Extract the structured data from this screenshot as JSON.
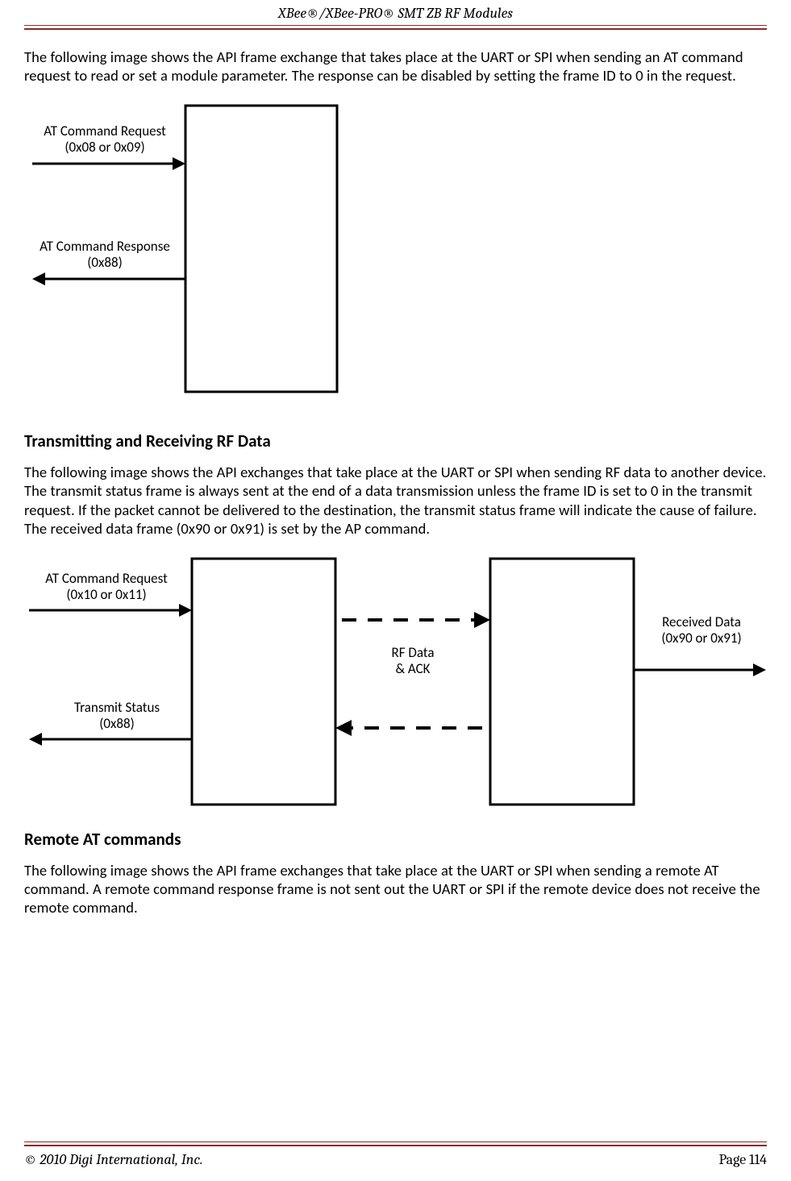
{
  "header": "XBee®/XBee-PRO® SMT ZB RF Modules",
  "paragraph1": "The following image shows the API frame exchange that takes place at the UART or SPI when sending an AT command request to read or set a module parameter. The response can be disabled by setting the frame ID to 0 in the request.",
  "diagram1": {
    "req_line1": "AT Command Request",
    "req_line2": "(0x08 or 0x09)",
    "resp_line1": "AT Command Response",
    "resp_line2": "(0x88)"
  },
  "heading2": "Transmitting and Receiving RF Data",
  "paragraph2": "The following image shows the API exchanges that take place at the UART or SPI when sending RF data to another device. The transmit status frame is always sent at the end of a data transmission unless the frame ID is set to 0 in the transmit request. If the packet cannot be delivered to the destination, the transmit status frame will indicate the cause of failure. The received data frame (0x90 or 0x91) is set by the AP command.",
  "diagram2": {
    "req_line1": "AT Command Request",
    "req_line2": "(0x10 or 0x11)",
    "mid_line1": "RF Data",
    "mid_line2": "& ACK",
    "resp_line1": "Transmit Status",
    "resp_line2": "(0x88)",
    "recv_line1": "Received Data",
    "recv_line2": "(0x90 or 0x91)"
  },
  "heading3": "Remote AT commands",
  "paragraph3": "The following image shows the API frame exchanges that take place at the UART or SPI when sending a remote AT command. A remote command response frame is not sent out the UART or SPI if the remote device does not receive the remote command.",
  "footer": {
    "copyright": "© 2010 Digi International, Inc.",
    "page": "Page 114"
  }
}
